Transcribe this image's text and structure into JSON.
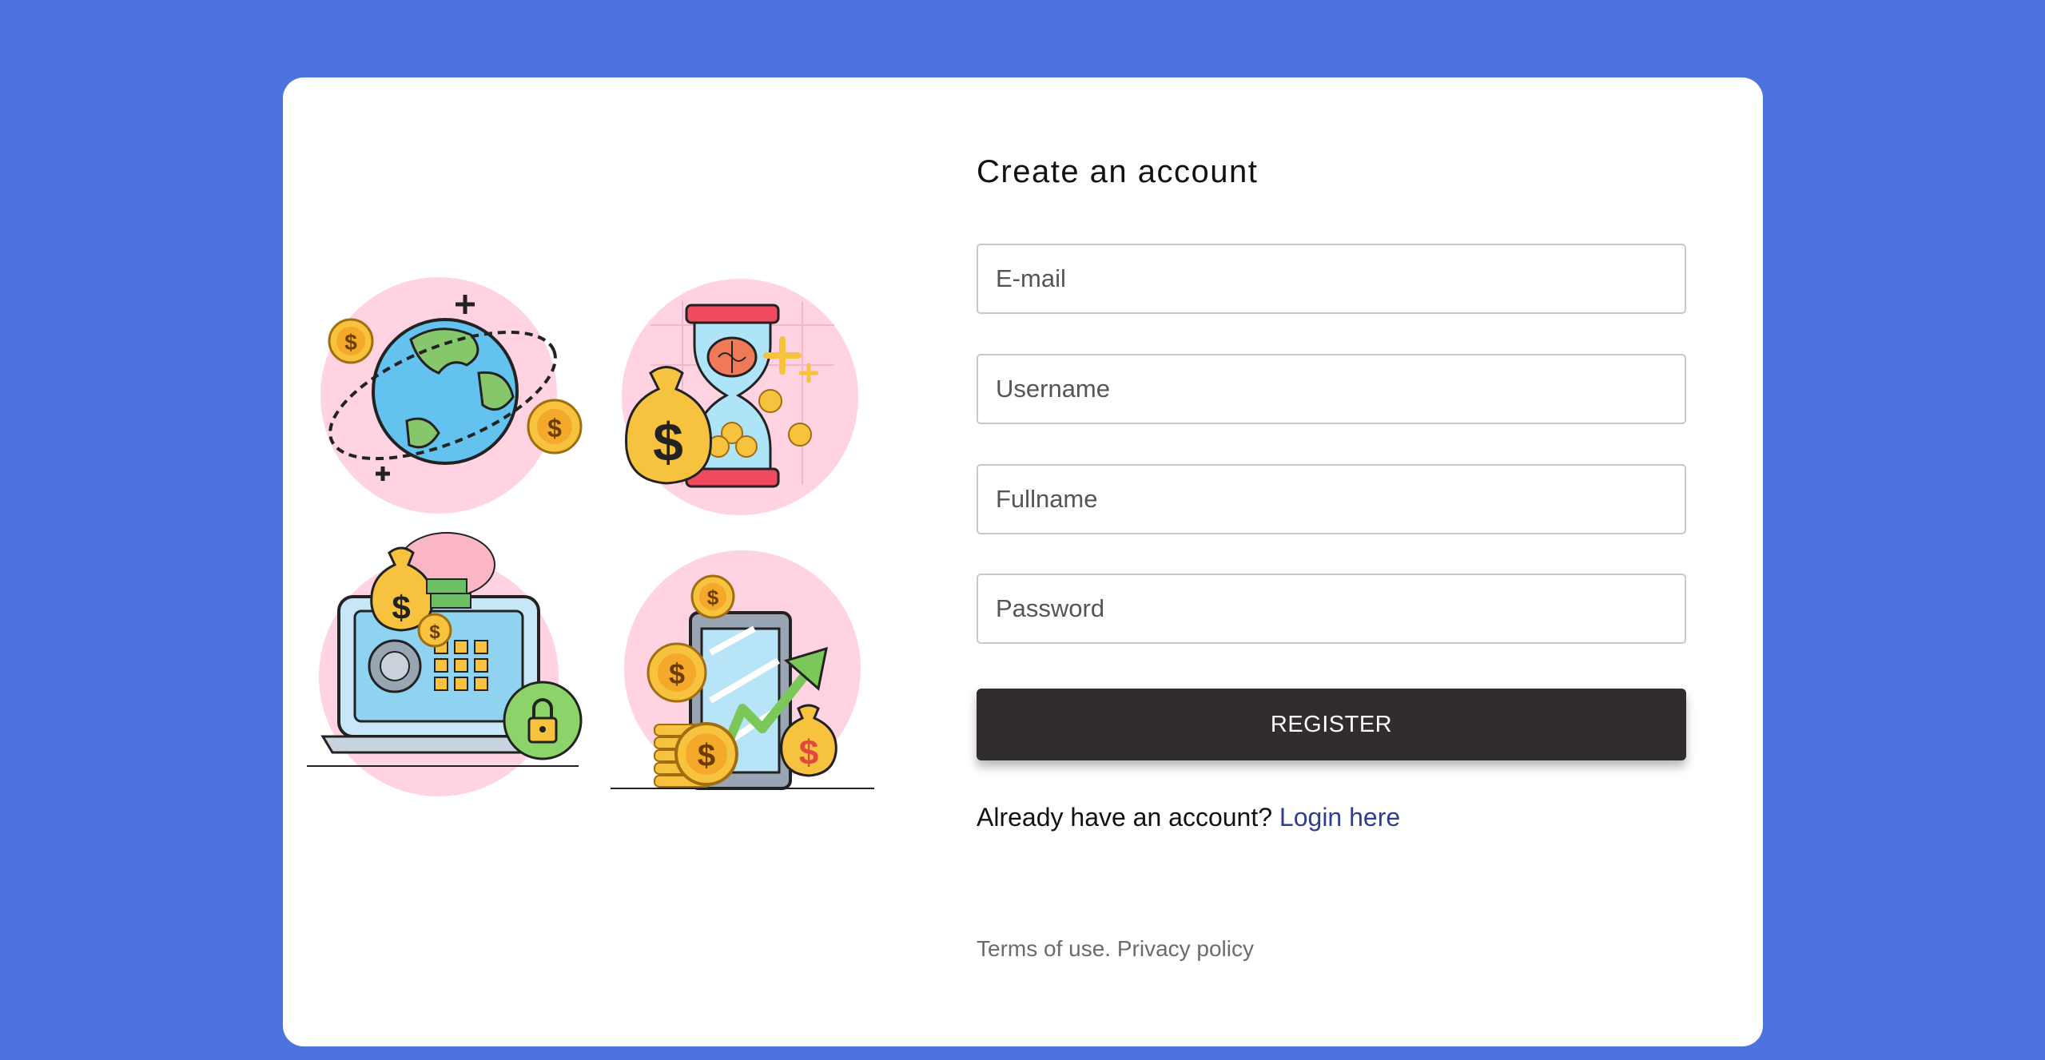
{
  "form": {
    "title": "Create an account",
    "email_placeholder": "E-mail",
    "username_placeholder": "Username",
    "fullname_placeholder": "Fullname",
    "password_placeholder": "Password",
    "register_label": "REGISTER",
    "login_prompt": "Already have an account?",
    "login_link": "Login here"
  },
  "footer": {
    "terms": "Terms of use.",
    "privacy": "Privacy policy"
  },
  "illustration": {
    "dollar_sign": "$"
  },
  "colors": {
    "background": "#4d73df",
    "button": "#322d2d",
    "link": "#2f3f8f"
  }
}
